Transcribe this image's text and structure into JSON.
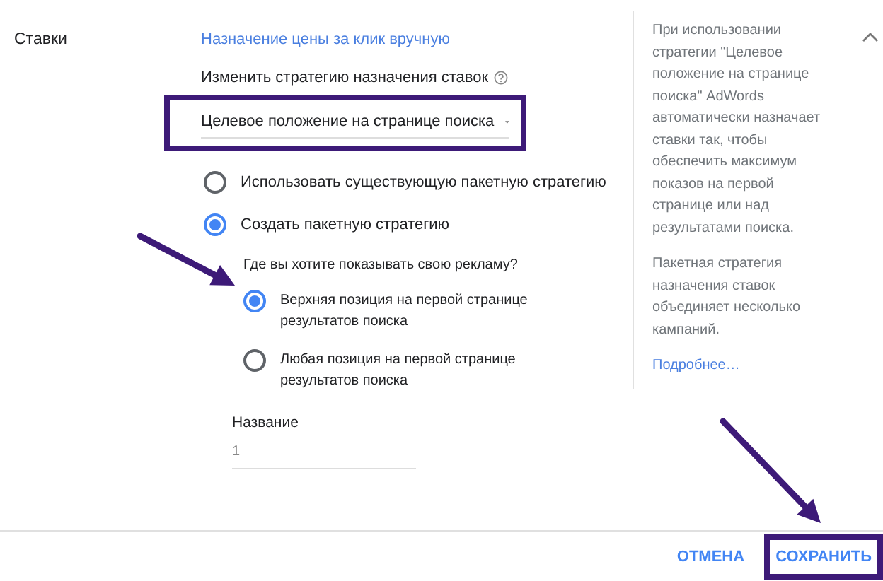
{
  "section": {
    "label": "Ставки",
    "link": "Назначение цены за клик вручную",
    "strategy_label": "Изменить стратегию назначения ставок",
    "strategy_dropdown": {
      "value": "Целевое положение на странице поиска",
      "highlighted": true
    },
    "options": [
      {
        "label": "Использовать существующую пакетную стратегию",
        "selected": false
      },
      {
        "label": "Создать пакетную стратегию",
        "selected": true
      }
    ],
    "question": "Где вы хотите показывать свою рекламу?",
    "positions": [
      {
        "label": "Верхняя позиция на первой странице результатов поиска",
        "selected": true,
        "arrow": true
      },
      {
        "label": "Любая позиция на первой странице результатов поиска",
        "selected": false,
        "arrow": false
      }
    ],
    "name_field": {
      "label": "Название",
      "value": "1"
    }
  },
  "help": {
    "expanded": true,
    "paragraphs": [
      "При использовании стратегии \"Целевое положение на странице поиска\" AdWords автоматически назначает ставки так, чтобы обеспечить максимум показов на первой странице или над результатами поиска.",
      "Пакетная стратегия назначения ставок объединяет несколько кампаний."
    ],
    "link": "Подробнее…"
  },
  "buttons": [
    {
      "label": "ОТМЕНА",
      "highlighted": false,
      "arrow": false
    },
    {
      "label": "СОХРАНИТЬ",
      "highlighted": true,
      "arrow": true
    }
  ]
}
